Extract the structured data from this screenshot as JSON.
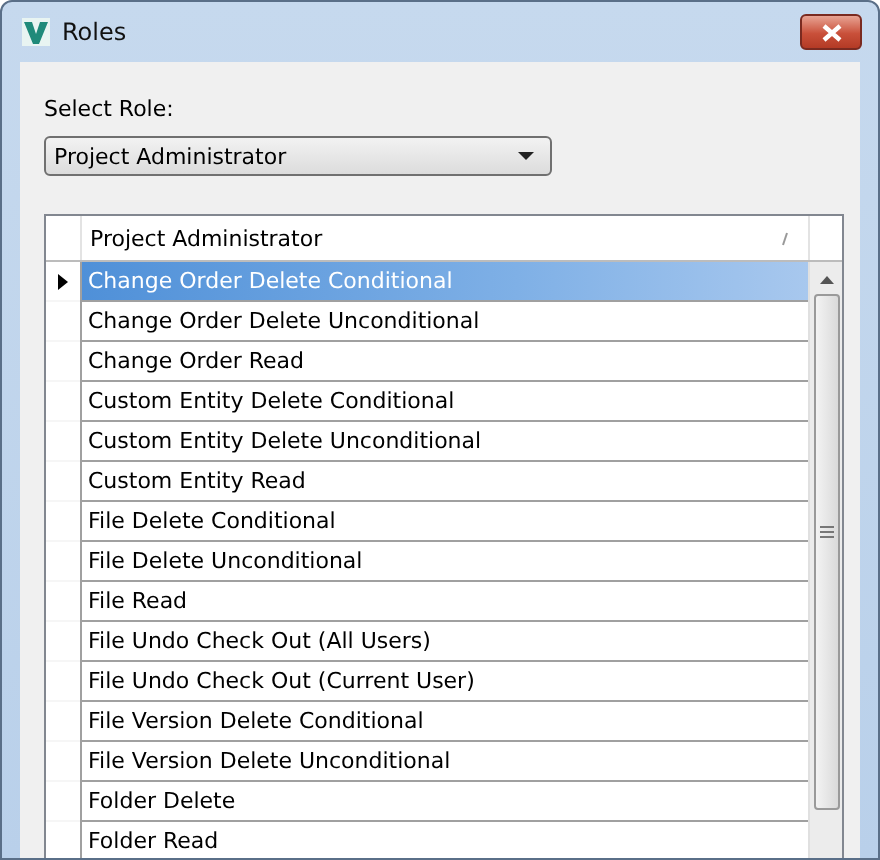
{
  "window": {
    "title": "Roles"
  },
  "role_select": {
    "label": "Select Role:",
    "value": "Project Administrator"
  },
  "table": {
    "columns": [
      "Project Administrator"
    ],
    "rows": [
      {
        "name": "Change Order Delete Conditional",
        "selected": true
      },
      {
        "name": "Change Order Delete Unconditional",
        "selected": false
      },
      {
        "name": "Change Order Read",
        "selected": false
      },
      {
        "name": "Custom Entity Delete Conditional",
        "selected": false
      },
      {
        "name": "Custom Entity Delete Unconditional",
        "selected": false
      },
      {
        "name": "Custom Entity Read",
        "selected": false
      },
      {
        "name": "File Delete Conditional",
        "selected": false
      },
      {
        "name": "File Delete Unconditional",
        "selected": false
      },
      {
        "name": "File Read",
        "selected": false
      },
      {
        "name": "File Undo Check Out (All Users)",
        "selected": false
      },
      {
        "name": "File Undo Check Out (Current User)",
        "selected": false
      },
      {
        "name": "File Version Delete Conditional",
        "selected": false
      },
      {
        "name": "File Version Delete Unconditional",
        "selected": false
      },
      {
        "name": "Folder Delete",
        "selected": false
      },
      {
        "name": "Folder Read",
        "selected": false
      }
    ]
  }
}
